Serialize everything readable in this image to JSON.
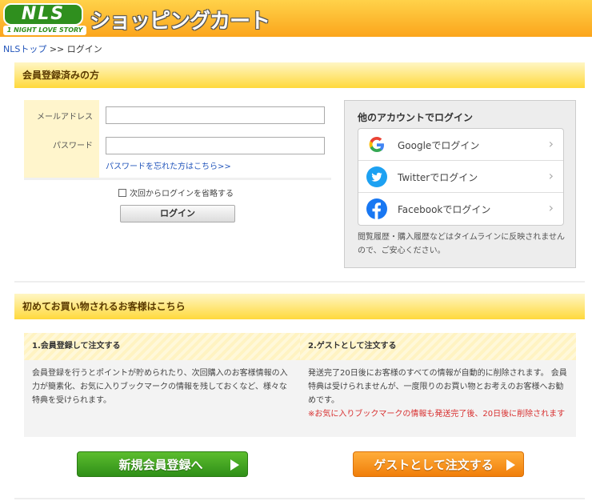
{
  "header": {
    "logo_text": "NLS",
    "logo_subtext": "1 NIGHT LOVE STORY",
    "title": "ショッピングカート"
  },
  "breadcrumb": {
    "home": "NLSトップ",
    "separator": ">>",
    "current": "ログイン"
  },
  "member_section": {
    "heading": "会員登録済みの方",
    "email_label": "メールアドレス",
    "password_label": "パスワード",
    "forgot_link": "パスワードを忘れた方はこちら>>",
    "remember_label": "次回からログインを省略する",
    "login_button": "ログイン"
  },
  "social_login": {
    "title": "他のアカウントでログイン",
    "providers": [
      {
        "label": "Googleでログイン",
        "icon": "google-icon"
      },
      {
        "label": "Twitterでログイン",
        "icon": "twitter-icon"
      },
      {
        "label": "Facebookでログイン",
        "icon": "facebook-icon"
      }
    ],
    "note": "閲覧履歴・購入履歴などはタイムラインに反映されませんので、ご安心ください。"
  },
  "new_section": {
    "heading": "初めてお買い物されるお客様はこちら",
    "option1": {
      "title": "1.会員登録して注文する",
      "text": "会員登録を行うとポイントが貯められたり、次回購入のお客様情報の入力が簡素化、お気に入りブックマークの情報を残しておくなど、様々な特典を受けられます。",
      "button": "新規会員登録へ"
    },
    "option2": {
      "title": "2.ゲストとして注文する",
      "text": "発送完了20日後にお客様のすべての情報が自動的に削除されます。 会員特典は受けられませんが、一度限りのお買い物とお考えのお客様へお勧めです。",
      "warning": "※お気に入りブックマークの情報も発送完了後、20日後に削除されます",
      "button": "ゲストとして注文する"
    }
  },
  "colors": {
    "header_orange": "#fba51c",
    "link_blue": "#2255bb",
    "green_button": "#2f8f18",
    "orange_button": "#f07e0a",
    "warning_red": "#d83030"
  }
}
